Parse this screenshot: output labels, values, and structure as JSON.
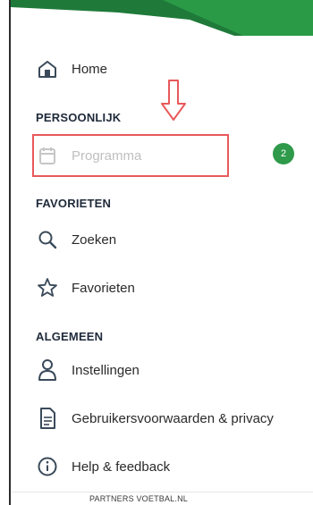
{
  "menu": {
    "home_label": "Home",
    "sections": {
      "persoonlijk": "PERSOONLIJK",
      "favorieten": "FAVORIETEN",
      "algemeen": "ALGEMEEN"
    },
    "programma_label": "Programma",
    "programma_badge": "2",
    "zoeken_label": "Zoeken",
    "favorieten_label": "Favorieten",
    "instellingen_label": "Instellingen",
    "voorwaarden_label": "Gebruikersvoorwaarden & privacy",
    "help_label": "Help & feedback"
  },
  "footer": {
    "text": "PARTNERS VOETBAL.NL"
  },
  "colors": {
    "accent_green": "#2e9a4a",
    "highlight_red": "#e8595a"
  },
  "icons": [
    "home-icon",
    "calendar-icon",
    "search-icon",
    "star-icon",
    "settings-icon",
    "document-icon",
    "info-icon",
    "arrow-down-icon"
  ]
}
